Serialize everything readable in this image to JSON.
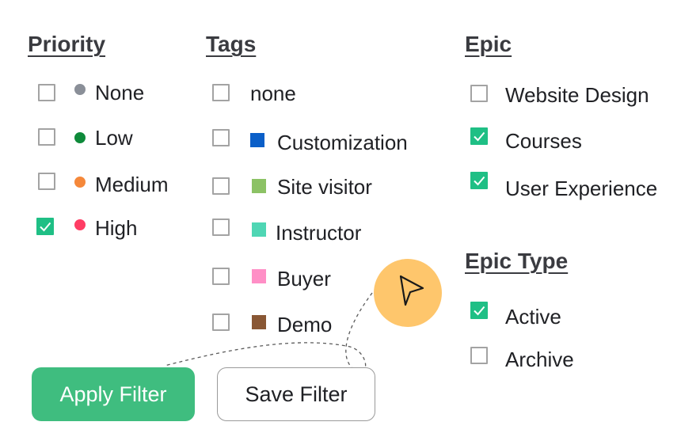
{
  "priority": {
    "heading": "Priority",
    "items": [
      {
        "label": "None",
        "checked": false,
        "color": "#8a8f98"
      },
      {
        "label": "Low",
        "checked": false,
        "color": "#0e8a3a"
      },
      {
        "label": "Medium",
        "checked": false,
        "color": "#f5883a"
      },
      {
        "label": "High",
        "checked": true,
        "color": "#ff3d64"
      }
    ]
  },
  "tags": {
    "heading": "Tags",
    "items": [
      {
        "label": "none",
        "checked": false,
        "color": null
      },
      {
        "label": "Customization",
        "checked": false,
        "color": "#0b5fc8"
      },
      {
        "label": "Site visitor",
        "checked": false,
        "color": "#8cc265"
      },
      {
        "label": "Instructor",
        "checked": false,
        "color": "#4fd6b4"
      },
      {
        "label": "Buyer",
        "checked": false,
        "color": "#ff8fc6"
      },
      {
        "label": "Demo",
        "checked": false,
        "color": "#895734"
      }
    ]
  },
  "epic": {
    "heading": "Epic",
    "items": [
      {
        "label": "Website Design",
        "checked": false
      },
      {
        "label": "Courses",
        "checked": true
      },
      {
        "label": "User Experience",
        "checked": true
      }
    ]
  },
  "epic_type": {
    "heading": "Epic Type",
    "items": [
      {
        "label": "Active",
        "checked": true
      },
      {
        "label": "Archive",
        "checked": false
      }
    ]
  },
  "buttons": {
    "apply_label": "Apply Filter",
    "save_label": "Save Filter"
  },
  "colors": {
    "check_fill": "#1fbf85",
    "apply_button": "#3fbd7f",
    "cursor_highlight": "#fec66c"
  },
  "cursor": {
    "icon": "pointer-arrow-icon"
  }
}
